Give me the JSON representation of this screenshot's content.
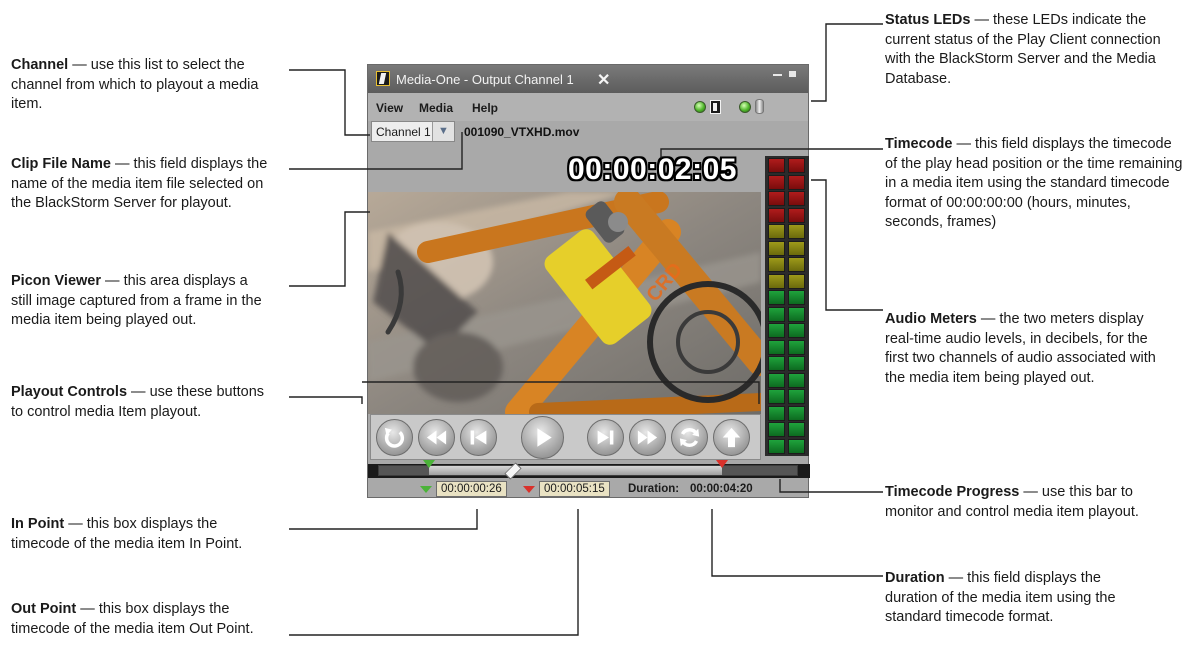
{
  "app": {
    "window_title": "Media-One - Output Channel 1",
    "menu": [
      "View",
      "Media",
      "Help"
    ],
    "channel_select": "Channel 1",
    "clip_file_name": "001090_VTXHD.mov",
    "timecode": "00:00:02:05",
    "in_point": "00:00:00:26",
    "out_point": "00:00:05:15",
    "duration_label": "Duration:",
    "duration_value": "00:00:04:20",
    "status_leds": [
      {
        "name": "server",
        "state": "ok",
        "color": "#4fb62b"
      },
      {
        "name": "database",
        "state": "ok",
        "color": "#4fb62b"
      }
    ],
    "playout_controls": [
      "loop-icon",
      "rewind-icon",
      "previous-icon",
      "play-icon",
      "next-icon",
      "fast-forward-icon",
      "sync-icon",
      "eject-icon"
    ],
    "progress": {
      "in_fraction": 0.12,
      "playhead_fraction": 0.32,
      "out_fraction": 0.82
    },
    "audio_meter_levels": [
      1.0,
      1.0
    ]
  },
  "callouts": {
    "channel": {
      "title": "Channel",
      "text": "use this list to select the channel from which to playout a media item."
    },
    "clip": {
      "title": "Clip File Name",
      "text": "this field displays the name of the media item file selected on the BlackStorm Server for playout."
    },
    "picon": {
      "title": "Picon Viewer",
      "text": "this area displays a still image captured from a frame in the media item being played out."
    },
    "playout": {
      "title": "Playout Controls",
      "text": "use these buttons to control media Item playout."
    },
    "inpoint": {
      "title": "In Point",
      "text": "this box displays the timecode of the media item In Point."
    },
    "outpoint": {
      "title": "Out Point",
      "text": "this box displays the timecode of the media item Out Point."
    },
    "status": {
      "title": "Status LEDs",
      "text": "these LEDs indicate the current status of the Play Client connection with the BlackStorm Server and the Media Database."
    },
    "timecode": {
      "title": "Timecode",
      "text": "this field displays the timecode of the play head position or the time remaining in a media item using the standard timecode format of 00:00:00:00 (hours, minutes, seconds, frames)"
    },
    "meters": {
      "title": "Audio Meters",
      "text": "the two meters display real-time audio levels, in decibels, for the first two channels of audio associated with the media item being played out."
    },
    "progress": {
      "title": "Timecode Progress",
      "text": "use this bar to monitor and control media item playout."
    },
    "duration": {
      "title": "Duration",
      "text": "this field displays the duration of the media item using the standard timecode format."
    }
  },
  "dash": " — "
}
